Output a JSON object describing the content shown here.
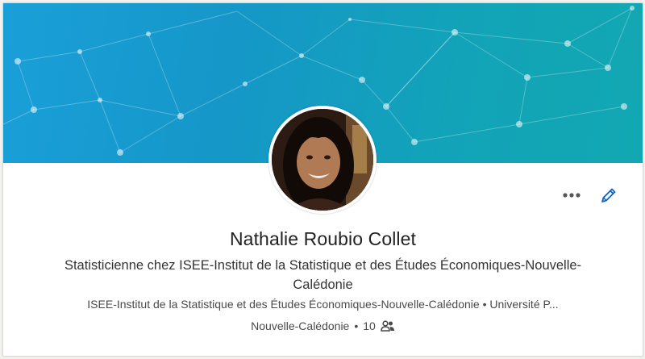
{
  "profile": {
    "name": "Nathalie Roubio Collet",
    "headline": "Statisticienne chez ISEE-Institut de la Statistique et des Études Économiques-Nouvelle-Calédonie",
    "education_line": "ISEE-Institut de la Statistique et des Études Économiques-Nouvelle-Calédonie • Université P...",
    "location": "Nouvelle-Calédonie",
    "separator": "•",
    "connections": "10"
  },
  "actions": {
    "more_icon": "more-horizontal-icon",
    "edit_icon": "pencil-icon"
  },
  "colors": {
    "banner_start": "#1a9fd9",
    "banner_end": "#12a8b2",
    "accent": "#0a66c2",
    "text_primary": "#222222"
  }
}
